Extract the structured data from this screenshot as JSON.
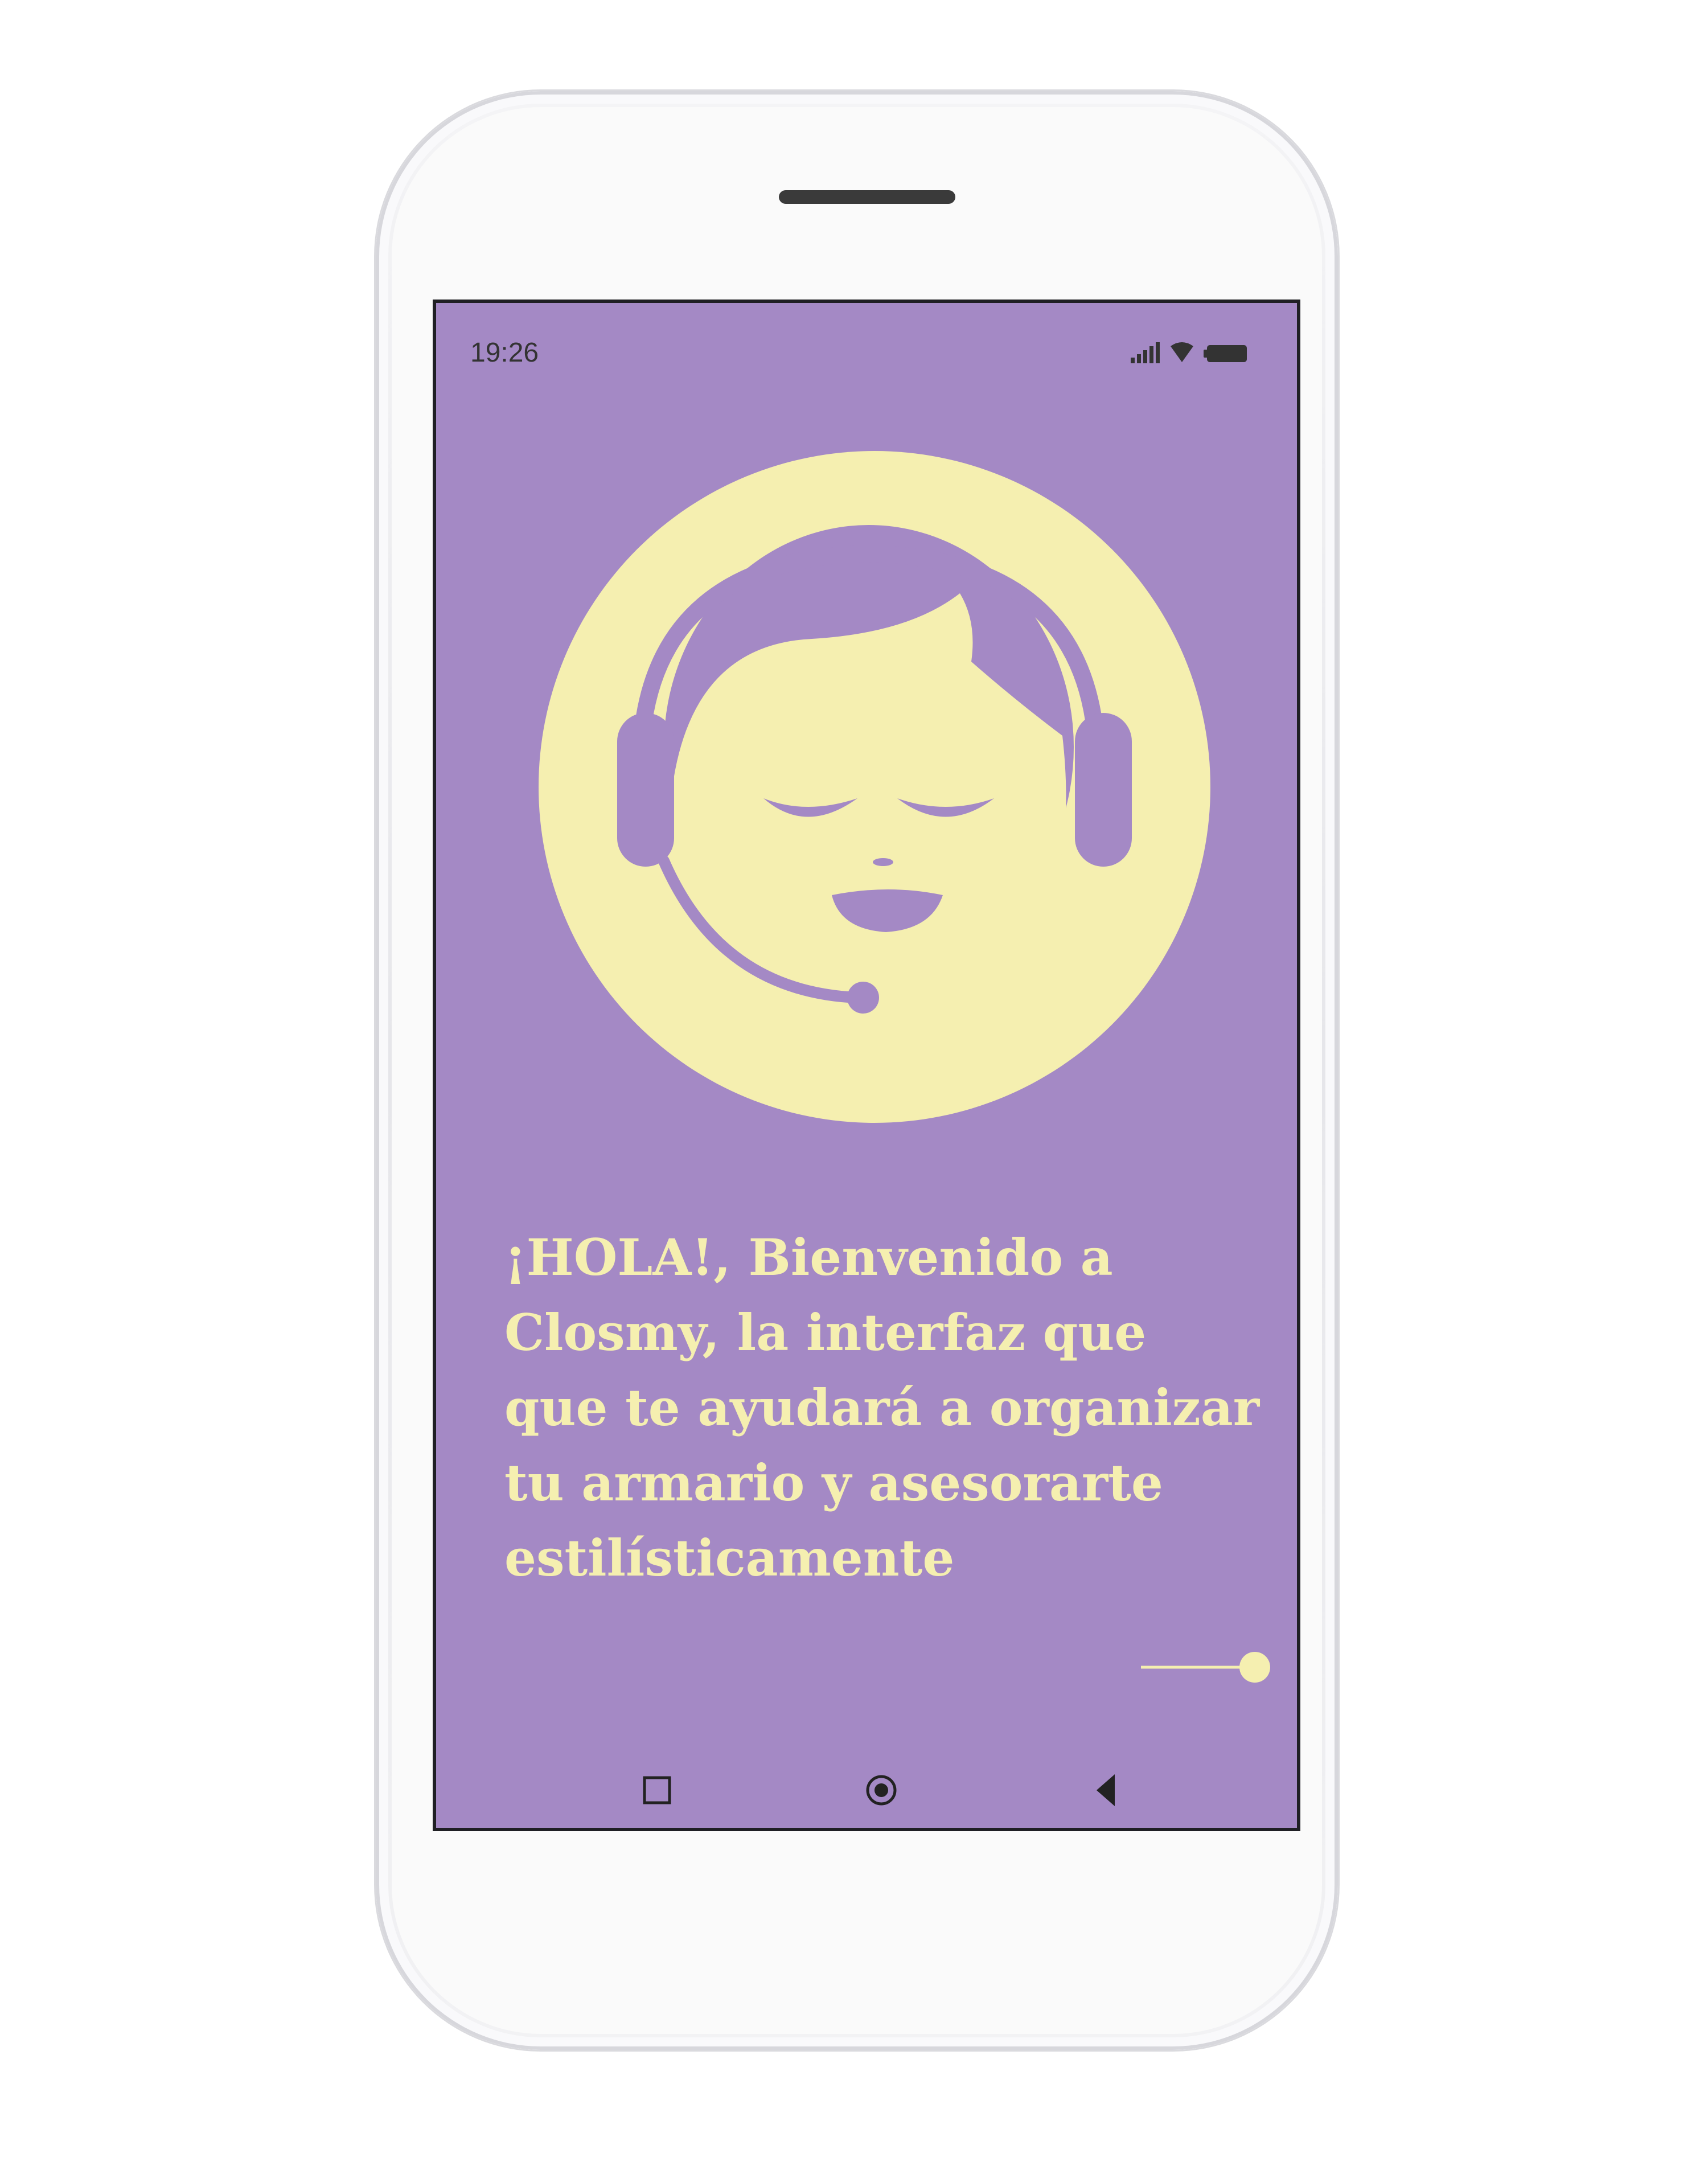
{
  "status_bar": {
    "time": "19:26",
    "icons": [
      "signal-icon",
      "wifi-icon",
      "battery-icon"
    ]
  },
  "welcome": {
    "lines": [
      "¡HOLA!, Bienvenido a",
      "Closmy, la interfaz que",
      "que te ayudará a organizar",
      "tu armario y asesorarte",
      "estilísticamente"
    ]
  },
  "avatar": {
    "icon": "assistant-headset-icon"
  },
  "pager": {
    "icon": "next-slider-icon"
  },
  "navbar": {
    "items": [
      "recent-apps-icon",
      "home-icon",
      "back-icon"
    ]
  },
  "colors": {
    "screen_background": "#a489c5",
    "accent_yellow": "#f5efb0",
    "icon_dark": "#333333"
  }
}
